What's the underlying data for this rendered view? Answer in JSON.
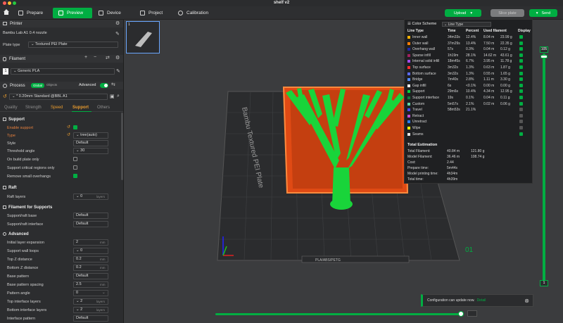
{
  "window": {
    "title": "shelf v2"
  },
  "tabs": [
    {
      "label": "Prepare"
    },
    {
      "label": "Preview"
    },
    {
      "label": "Device"
    },
    {
      "label": "Project"
    },
    {
      "label": "Calibration"
    }
  ],
  "actions": {
    "upload": "Upload",
    "slice": "Slice plate",
    "send": "Send"
  },
  "printer": {
    "header": "Printer",
    "name": "Bambu Lab A1 0.4 nozzle",
    "plate_type_label": "Plate type",
    "plate_type": "Textured PEI Plate"
  },
  "filament": {
    "header": "Filament",
    "index": "1",
    "name": "Generic PLA"
  },
  "process": {
    "header": "Process",
    "mode_global": "Global",
    "mode_objects": "Objects",
    "advanced_label": "Advanced",
    "preset": "* 0.20mm Standard @BBL A1",
    "subtabs": [
      "Quality",
      "Strength",
      "Speed",
      "Support",
      "Others"
    ]
  },
  "support": {
    "title": "Support",
    "rows": [
      {
        "label": "Enable support",
        "checked": true
      },
      {
        "label": "Type",
        "value": "tree(auto)"
      },
      {
        "label": "Style",
        "value": "Default"
      },
      {
        "label": "Threshold angle",
        "value": "30"
      },
      {
        "label": "On build plate only",
        "checked": false
      },
      {
        "label": "Support critical regions only",
        "checked": false
      },
      {
        "label": "Remove small overhangs",
        "checked": true
      }
    ]
  },
  "raft": {
    "title": "Raft",
    "layers_label": "Raft layers",
    "layers_value": "0",
    "layers_unit": "layers"
  },
  "filament_support": {
    "title": "Filament for Supports",
    "base_label": "Support/raft base",
    "base_value": "Default",
    "interface_label": "Support/raft interface",
    "interface_value": "Default"
  },
  "advanced": {
    "title": "Advanced",
    "rows": [
      {
        "label": "Initial layer expansion",
        "value": "2",
        "unit": "mm"
      },
      {
        "label": "Support wall loops",
        "value": "0",
        "unit": ""
      },
      {
        "label": "Top Z distance",
        "value": "0.2",
        "unit": "mm"
      },
      {
        "label": "Bottom Z distance",
        "value": "0.2",
        "unit": "mm"
      },
      {
        "label": "Base pattern",
        "value": "Default",
        "unit": ""
      },
      {
        "label": "Base pattern spacing",
        "value": "2.5",
        "unit": "mm"
      },
      {
        "label": "Pattern angle",
        "value": "0",
        "unit": ""
      },
      {
        "label": "Top interface layers",
        "value": "2",
        "unit": "layers"
      },
      {
        "label": "Bottom interface layers",
        "value": "2",
        "unit": "layers"
      },
      {
        "label": "Interface pattern",
        "value": "Default",
        "unit": ""
      }
    ]
  },
  "plate": {
    "label": "Bambu Textured PEI Plate",
    "strip": "PLA/ABS/PETG",
    "number": "01"
  },
  "color_scheme": {
    "header": "Color Scheme",
    "mode": "Line Type",
    "columns": [
      "Line Type",
      "Time",
      "Percent",
      "Used filament",
      "Display"
    ],
    "rows": [
      {
        "name": "Inner wall",
        "time": "34m33s",
        "percent": "12.4%",
        "len": "8.04 m",
        "weight": "23.99 g",
        "color": "#ffb200"
      },
      {
        "name": "Outer wall",
        "time": "37m29s",
        "percent": "13.4%",
        "len": "7.50 m",
        "weight": "22.35 g",
        "color": "#ff7d00"
      },
      {
        "name": "Overhang wall",
        "time": "57s",
        "percent": "0.3%",
        "len": "0.04 m",
        "weight": "0.12 g",
        "color": "#1e2aa8"
      },
      {
        "name": "Sparse infill",
        "time": "1h19m",
        "percent": "28.1%",
        "len": "14.62 m",
        "weight": "43.61 g",
        "color": "#a0205f"
      },
      {
        "name": "Internal solid infill",
        "time": "18m45s",
        "percent": "6.7%",
        "len": "3.95 m",
        "weight": "11.78 g",
        "color": "#a24af2"
      },
      {
        "name": "Top surface",
        "time": "3m32s",
        "percent": "1.3%",
        "len": "0.63 m",
        "weight": "1.87 g",
        "color": "#ff2e2e"
      },
      {
        "name": "Bottom surface",
        "time": "3m32s",
        "percent": "1.3%",
        "len": "0.55 m",
        "weight": "1.65 g",
        "color": "#5a6aff"
      },
      {
        "name": "Bridge",
        "time": "7m40s",
        "percent": "2.8%",
        "len": "1.11 m",
        "weight": "3.30 g",
        "color": "#4f8aff"
      },
      {
        "name": "Gap infill",
        "time": "6s",
        "percent": "<0.1%",
        "len": "0.00 m",
        "weight": "0.00 g",
        "color": "#ffffff"
      },
      {
        "name": "Support",
        "time": "29m6s",
        "percent": "10.4%",
        "len": "4.34 m",
        "weight": "12.95 g",
        "color": "#00d33a"
      },
      {
        "name": "Support interface",
        "time": "19s",
        "percent": "0.1%",
        "len": "0.04 m",
        "weight": "0.11 g",
        "color": "#107a3c"
      },
      {
        "name": "Custom",
        "time": "5m57s",
        "percent": "2.1%",
        "len": "0.02 m",
        "weight": "0.06 g",
        "color": "#5ed7a7"
      },
      {
        "name": "Travel",
        "time": "58m53s",
        "percent": "21.1%",
        "len": "",
        "weight": "",
        "color": "#4646ff"
      },
      {
        "name": "Retract",
        "time": "",
        "percent": "",
        "len": "",
        "weight": "",
        "color": "#c34bd6"
      },
      {
        "name": "Unretract",
        "time": "",
        "percent": "",
        "len": "",
        "weight": "",
        "color": "#2b7bff"
      },
      {
        "name": "Wipe",
        "time": "",
        "percent": "",
        "len": "",
        "weight": "",
        "color": "#ffff00"
      },
      {
        "name": "Seams",
        "time": "",
        "percent": "",
        "len": "",
        "weight": "",
        "color": "#e6e6e6"
      }
    ]
  },
  "estimation": {
    "title": "Total Estimation",
    "rows": [
      {
        "label": "Total Filament:",
        "v1": "40.84 m",
        "v2": "121.80 g"
      },
      {
        "label": "Model Filament:",
        "v1": "36.46 m",
        "v2": "108.74 g"
      },
      {
        "label": "Cost:",
        "v1": "2.44",
        "v2": ""
      },
      {
        "label": "Prepare time:",
        "v1": "5m44s",
        "v2": ""
      },
      {
        "label": "Model printing time:",
        "v1": "4h34m",
        "v2": ""
      },
      {
        "label": "Total time:",
        "v1": "4h39m",
        "v2": ""
      }
    ]
  },
  "layer_slider": {
    "top": "105",
    "bottom": "1"
  },
  "notification": {
    "text": "Configuration can update now.",
    "link": "Detail"
  },
  "plate_thumb": {
    "index": "1"
  }
}
